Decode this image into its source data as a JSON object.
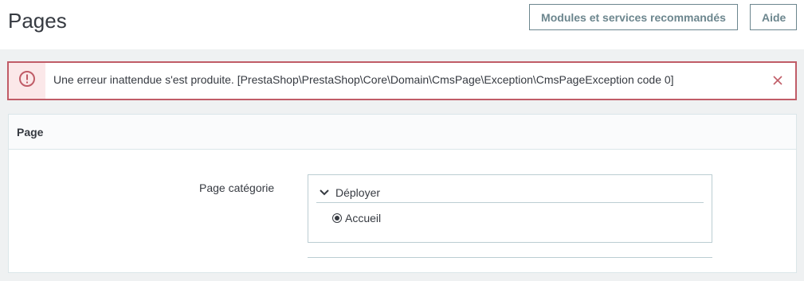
{
  "header": {
    "title": "Pages",
    "buttons": {
      "modules": "Modules et services recommandés",
      "help": "Aide"
    }
  },
  "alert": {
    "icon": "error-circle-icon",
    "message": "Une erreur inattendue s'est produite. [PrestaShop\\PrestaShop\\Core\\Domain\\CmsPage\\Exception\\CmsPageException code 0]",
    "close_icon": "close-icon",
    "colors": {
      "border": "#c05c67",
      "icon": "#c05c67",
      "icon_bg": "#fbe8e9"
    }
  },
  "card": {
    "title": "Page",
    "field": {
      "label": "Page catégorie",
      "toggle_label": "Déployer",
      "toggle_icon": "chevron-down-icon",
      "options": [
        {
          "label": "Accueil",
          "selected": true
        }
      ]
    }
  }
}
